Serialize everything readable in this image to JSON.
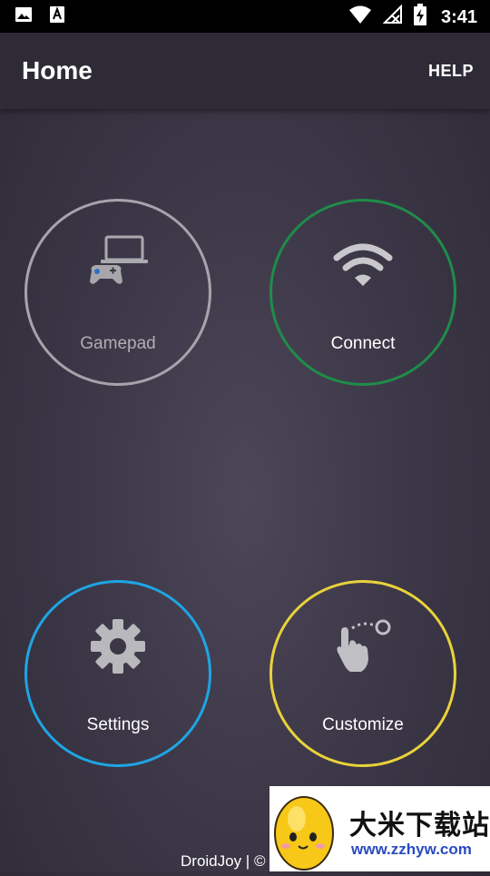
{
  "status_bar": {
    "time": "3:41",
    "icons": [
      "image-icon",
      "font-icon",
      "wifi-icon",
      "signal-off-icon",
      "battery-charging-icon"
    ]
  },
  "app_bar": {
    "title": "Home",
    "help_label": "HELP"
  },
  "tiles": [
    {
      "label": "Gamepad",
      "icon": "laptop-gamepad-icon",
      "color": "#a6a4ab"
    },
    {
      "label": "Connect",
      "icon": "wifi-icon",
      "color": "#1f8c4a"
    },
    {
      "label": "Settings",
      "icon": "gear-icon",
      "color": "#1ea5e3"
    },
    {
      "label": "Customize",
      "icon": "touch-gesture-icon",
      "color": "#e8d23a"
    }
  ],
  "footer": {
    "text": "DroidJoy | ©"
  },
  "watermark": {
    "name_cn": "大米下载站",
    "url": "www.zzhyw.com"
  }
}
